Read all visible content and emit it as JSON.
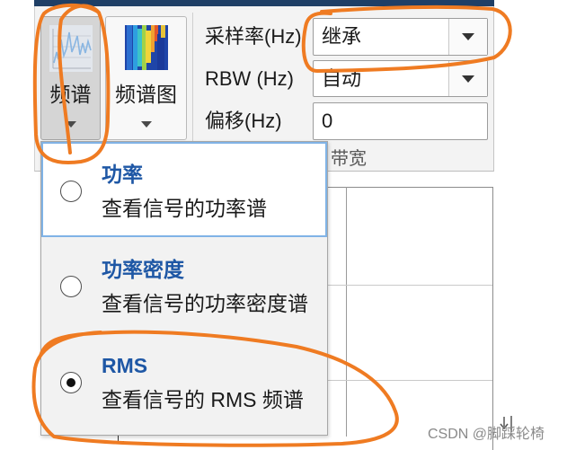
{
  "colors": {
    "accent": "#1e57a5",
    "annotation": "#ef7b22",
    "toolstrip": "#f3f3f3"
  },
  "toolstrip": {
    "spectrum_button": {
      "label": "频谱",
      "icon": "spectrum-icon",
      "pressed": true
    },
    "spectrogram_button": {
      "label": "频谱图",
      "icon": "spectrogram-icon"
    },
    "sample_rate": {
      "label": "采样率(Hz)",
      "value": "继承"
    },
    "rbw": {
      "label": "RBW (Hz)",
      "value": "自动"
    },
    "offset": {
      "label": "偏移(Hz)",
      "value": "0"
    },
    "section_label": "带宽"
  },
  "spectrum_menu": {
    "items": [
      {
        "title": "功率",
        "description": "查看信号的功率谱",
        "selected": false
      },
      {
        "title": "功率密度",
        "description": "查看信号的功率密度谱",
        "selected": false
      },
      {
        "title": "RMS",
        "description": "查看信号的 RMS 频谱",
        "selected": true
      }
    ]
  },
  "watermark": "CSDN @脚踩轮椅"
}
